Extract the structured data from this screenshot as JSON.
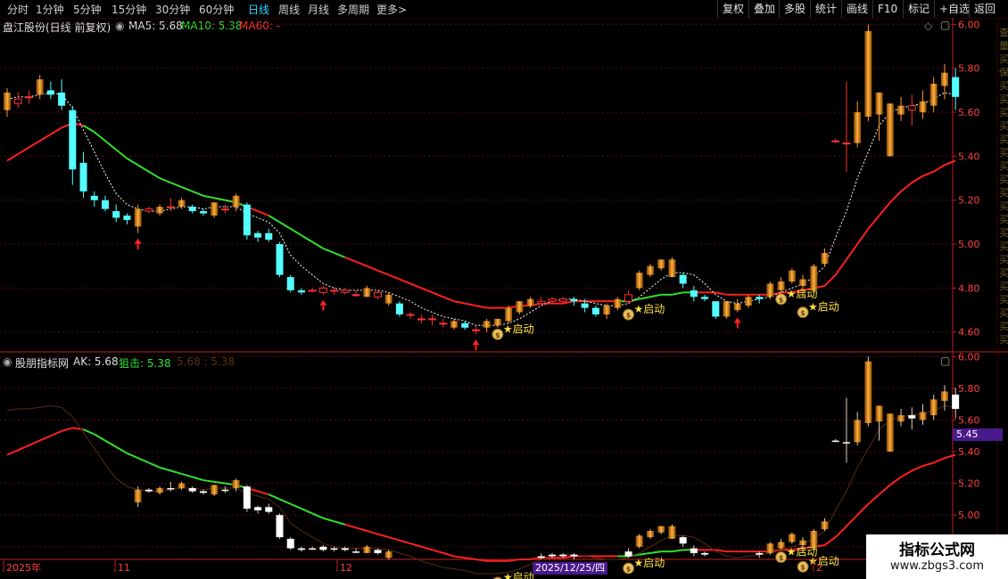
{
  "toolbar": {
    "periods": [
      "分时",
      "1分钟",
      "5分钟",
      "15分钟",
      "30分钟",
      "60分钟",
      "日线",
      "周线",
      "月线",
      "多周期",
      "更多"
    ],
    "active_period": "日线",
    "more_arrow": ">",
    "actions": [
      "复权",
      "叠加",
      "多股",
      "统计",
      "画线",
      "F10",
      "标记",
      "+自选",
      "返回"
    ]
  },
  "main_header": {
    "stock_title": "盘江股份(日线 前复权)",
    "ma5_label": "MA5: 5.68",
    "ma10_label": "MA10: 5.38",
    "ma60_label": "MA60: -"
  },
  "sub_header": {
    "indicator_name": "股朋指标网",
    "ak_label": "AK: 5.68",
    "zj_label": "狙击: 5.38",
    "extra_label": "5.68 : 5.38"
  },
  "signal_label": "★启动",
  "cursor_price": "5.45",
  "cursor_date": "2025/12/25/四",
  "x_axis_labels": [
    "2025年",
    "11",
    "12",
    "2"
  ],
  "right_strip_chars": [
    "查",
    "量",
    "买",
    "保",
    "买",
    "买",
    "买",
    "买",
    "买",
    "买",
    "买",
    "买",
    "买",
    "买",
    "买",
    "买",
    "买",
    "买",
    "买",
    "买",
    "买",
    "买",
    "买",
    "买",
    "买",
    "买",
    "买",
    "买",
    "买",
    "买",
    "买",
    "买",
    "买",
    "买",
    "买",
    "买",
    "买",
    "买",
    "买",
    "买",
    "买",
    "买",
    "买",
    "买",
    "买",
    "买",
    "买",
    "买",
    "买",
    "买",
    "买"
  ],
  "watermark": {
    "logo": "指标公式网",
    "url": "www.zbgs3.com"
  },
  "colors": {
    "up": "#ff3232",
    "down": "#54ffff",
    "ma_red": "#ff2020",
    "ma_green": "#30e030",
    "grid": "#5a0a0a",
    "axis": "#c02020"
  },
  "chart_data": {
    "type": "candlestick",
    "main_axis": {
      "yticks": [
        4.6,
        4.8,
        5.0,
        5.2,
        5.4,
        5.6,
        5.8,
        6.0
      ],
      "ylim": [
        4.53,
        6.03
      ]
    },
    "sub_axis": {
      "yticks": [
        4.8,
        5.0,
        5.2,
        5.4,
        5.6,
        5.8,
        6.0
      ],
      "ylim": [
        4.72,
        6.03
      ]
    },
    "candles": [
      {
        "o": 5.61,
        "c": 5.69,
        "h": 5.71,
        "l": 5.58
      },
      {
        "o": 5.64,
        "c": 5.66,
        "h": 5.69,
        "l": 5.62
      },
      {
        "o": 5.67,
        "c": 5.67,
        "h": 5.7,
        "l": 5.64
      },
      {
        "o": 5.68,
        "c": 5.75,
        "h": 5.77,
        "l": 5.66
      },
      {
        "o": 5.7,
        "c": 5.68,
        "h": 5.74,
        "l": 5.66
      },
      {
        "o": 5.69,
        "c": 5.63,
        "h": 5.75,
        "l": 5.61
      },
      {
        "o": 5.61,
        "c": 5.34,
        "h": 5.63,
        "l": 5.27
      },
      {
        "o": 5.37,
        "c": 5.24,
        "h": 5.42,
        "l": 5.21
      },
      {
        "o": 5.22,
        "c": 5.2,
        "h": 5.24,
        "l": 5.17
      },
      {
        "o": 5.2,
        "c": 5.16,
        "h": 5.22,
        "l": 5.15
      },
      {
        "o": 5.15,
        "c": 5.12,
        "h": 5.18,
        "l": 5.1
      },
      {
        "o": 5.13,
        "c": 5.11,
        "h": 5.14,
        "l": 5.09
      },
      {
        "o": 5.08,
        "c": 5.16,
        "h": 5.18,
        "l": 5.05
      },
      {
        "o": 5.15,
        "c": 5.16,
        "h": 5.17,
        "l": 5.14
      },
      {
        "o": 5.14,
        "c": 5.17,
        "h": 5.18,
        "l": 5.13
      },
      {
        "o": 5.17,
        "c": 5.17,
        "h": 5.21,
        "l": 5.15
      },
      {
        "o": 5.17,
        "c": 5.2,
        "h": 5.21,
        "l": 5.16
      },
      {
        "o": 5.17,
        "c": 5.15,
        "h": 5.18,
        "l": 5.14
      },
      {
        "o": 5.15,
        "c": 5.14,
        "h": 5.16,
        "l": 5.13
      },
      {
        "o": 5.13,
        "c": 5.19,
        "h": 5.19,
        "l": 5.12
      },
      {
        "o": 5.16,
        "c": 5.16,
        "h": 5.18,
        "l": 5.14
      },
      {
        "o": 5.17,
        "c": 5.22,
        "h": 5.23,
        "l": 5.15
      },
      {
        "o": 5.18,
        "c": 5.04,
        "h": 5.19,
        "l": 5.02
      },
      {
        "o": 5.05,
        "c": 5.03,
        "h": 5.06,
        "l": 5.01
      },
      {
        "o": 5.05,
        "c": 5.02,
        "h": 5.07,
        "l": 5.01
      },
      {
        "o": 5.0,
        "c": 4.86,
        "h": 5.01,
        "l": 4.85
      },
      {
        "o": 4.85,
        "c": 4.79,
        "h": 4.86,
        "l": 4.78
      },
      {
        "o": 4.79,
        "c": 4.78,
        "h": 4.8,
        "l": 4.77
      },
      {
        "o": 4.79,
        "c": 4.79,
        "h": 4.8,
        "l": 4.78
      },
      {
        "o": 4.78,
        "c": 4.8,
        "h": 4.81,
        "l": 4.77
      },
      {
        "o": 4.79,
        "c": 4.79,
        "h": 4.8,
        "l": 4.77
      },
      {
        "o": 4.78,
        "c": 4.79,
        "h": 4.8,
        "l": 4.77
      },
      {
        "o": 4.77,
        "c": 4.77,
        "h": 4.79,
        "l": 4.76
      },
      {
        "o": 4.76,
        "c": 4.8,
        "h": 4.81,
        "l": 4.76
      },
      {
        "o": 4.76,
        "c": 4.78,
        "h": 4.79,
        "l": 4.75
      },
      {
        "o": 4.73,
        "c": 4.77,
        "h": 4.78,
        "l": 4.72
      },
      {
        "o": 4.73,
        "c": 4.68,
        "h": 4.74,
        "l": 4.67
      },
      {
        "o": 4.68,
        "c": 4.68,
        "h": 4.69,
        "l": 4.66
      },
      {
        "o": 4.66,
        "c": 4.66,
        "h": 4.68,
        "l": 4.64
      },
      {
        "o": 4.66,
        "c": 4.66,
        "h": 4.68,
        "l": 4.63
      },
      {
        "o": 4.64,
        "c": 4.64,
        "h": 4.66,
        "l": 4.62
      },
      {
        "o": 4.62,
        "c": 4.65,
        "h": 4.66,
        "l": 4.61
      },
      {
        "o": 4.64,
        "c": 4.62,
        "h": 4.65,
        "l": 4.61
      },
      {
        "o": 4.61,
        "c": 4.61,
        "h": 4.63,
        "l": 4.59
      },
      {
        "o": 4.62,
        "c": 4.65,
        "h": 4.66,
        "l": 4.6
      },
      {
        "o": 4.63,
        "c": 4.66,
        "h": 4.66,
        "l": 4.62
      },
      {
        "o": 4.65,
        "c": 4.71,
        "h": 4.72,
        "l": 4.64
      },
      {
        "o": 4.69,
        "c": 4.74,
        "h": 4.74,
        "l": 4.68
      },
      {
        "o": 4.72,
        "c": 4.75,
        "h": 4.76,
        "l": 4.71
      },
      {
        "o": 4.73,
        "c": 4.74,
        "h": 4.76,
        "l": 4.72
      },
      {
        "o": 4.74,
        "c": 4.75,
        "h": 4.76,
        "l": 4.73
      },
      {
        "o": 4.74,
        "c": 4.75,
        "h": 4.76,
        "l": 4.73
      },
      {
        "o": 4.75,
        "c": 4.74,
        "h": 4.76,
        "l": 4.72
      },
      {
        "o": 4.73,
        "c": 4.71,
        "h": 4.75,
        "l": 4.69
      },
      {
        "o": 4.71,
        "c": 4.68,
        "h": 4.72,
        "l": 4.67
      },
      {
        "o": 4.68,
        "c": 4.72,
        "h": 4.73,
        "l": 4.66
      },
      {
        "o": 4.71,
        "c": 4.75,
        "h": 4.76,
        "l": 4.7
      },
      {
        "o": 4.74,
        "c": 4.77,
        "h": 4.79,
        "l": 4.73
      },
      {
        "o": 4.8,
        "c": 4.87,
        "h": 4.88,
        "l": 4.79
      },
      {
        "o": 4.86,
        "c": 4.9,
        "h": 4.91,
        "l": 4.85
      },
      {
        "o": 4.89,
        "c": 4.93,
        "h": 4.93,
        "l": 4.88
      },
      {
        "o": 4.85,
        "c": 4.93,
        "h": 4.94,
        "l": 4.85
      },
      {
        "o": 4.86,
        "c": 4.82,
        "h": 4.87,
        "l": 4.8
      },
      {
        "o": 4.79,
        "c": 4.76,
        "h": 4.81,
        "l": 4.74
      },
      {
        "o": 4.76,
        "c": 4.75,
        "h": 4.77,
        "l": 4.74
      },
      {
        "o": 4.74,
        "c": 4.67,
        "h": 4.74,
        "l": 4.66
      },
      {
        "o": 4.67,
        "c": 4.74,
        "h": 4.74,
        "l": 4.66
      },
      {
        "o": 4.7,
        "c": 4.73,
        "h": 4.75,
        "l": 4.69
      },
      {
        "o": 4.72,
        "c": 4.76,
        "h": 4.77,
        "l": 4.71
      },
      {
        "o": 4.76,
        "c": 4.75,
        "h": 4.77,
        "l": 4.73
      },
      {
        "o": 4.76,
        "c": 4.82,
        "h": 4.83,
        "l": 4.75
      },
      {
        "o": 4.79,
        "c": 4.83,
        "h": 4.85,
        "l": 4.78
      },
      {
        "o": 4.83,
        "c": 4.88,
        "h": 4.89,
        "l": 4.82
      },
      {
        "o": 4.81,
        "c": 4.84,
        "h": 4.86,
        "l": 4.76
      },
      {
        "o": 4.79,
        "c": 4.9,
        "h": 4.91,
        "l": 4.78
      },
      {
        "o": 4.91,
        "c": 4.96,
        "h": 4.98,
        "l": 4.9
      },
      {
        "o": 5.47,
        "c": 5.47,
        "h": 5.48,
        "l": 5.46
      },
      {
        "o": 5.46,
        "c": 5.46,
        "h": 5.74,
        "l": 5.33
      },
      {
        "o": 5.46,
        "c": 5.6,
        "h": 5.65,
        "l": 5.44
      },
      {
        "o": 5.58,
        "c": 5.97,
        "h": 6.0,
        "l": 5.56
      },
      {
        "o": 5.59,
        "c": 5.69,
        "h": 5.69,
        "l": 5.47
      },
      {
        "o": 5.4,
        "c": 5.64,
        "h": 5.64,
        "l": 5.4
      },
      {
        "o": 5.59,
        "c": 5.63,
        "h": 5.67,
        "l": 5.56
      },
      {
        "o": 5.61,
        "c": 5.63,
        "h": 5.68,
        "l": 5.54
      },
      {
        "o": 5.6,
        "c": 5.65,
        "h": 5.7,
        "l": 5.57
      },
      {
        "o": 5.63,
        "c": 5.73,
        "h": 5.76,
        "l": 5.6
      },
      {
        "o": 5.72,
        "c": 5.78,
        "h": 5.82,
        "l": 5.66
      },
      {
        "o": 5.76,
        "c": 5.67,
        "h": 5.8,
        "l": 5.61
      }
    ],
    "ma5": [
      5.66,
      5.67,
      5.67,
      5.68,
      5.69,
      5.68,
      5.62,
      5.52,
      5.42,
      5.32,
      5.23,
      5.18,
      5.16,
      5.15,
      5.15,
      5.16,
      5.17,
      5.17,
      5.16,
      5.17,
      5.17,
      5.17,
      5.14,
      5.12,
      5.1,
      5.05,
      4.95,
      4.9,
      4.86,
      4.82,
      4.8,
      4.79,
      4.79,
      4.79,
      4.79,
      4.78,
      4.76,
      4.74,
      4.71,
      4.69,
      4.67,
      4.66,
      4.65,
      4.63,
      4.63,
      4.63,
      4.64,
      4.66,
      4.69,
      4.72,
      4.74,
      4.75,
      4.75,
      4.74,
      4.73,
      4.72,
      4.72,
      4.73,
      4.76,
      4.8,
      4.84,
      4.87,
      4.87,
      4.86,
      4.82,
      4.77,
      4.74,
      4.73,
      4.74,
      4.75,
      4.76,
      4.78,
      4.8,
      4.82,
      4.85,
      4.9,
      5.03,
      5.15,
      5.3,
      5.42,
      5.54,
      5.6,
      5.62,
      5.63,
      5.64,
      5.66,
      5.69,
      5.68
    ],
    "zj": [
      5.38,
      5.41,
      5.44,
      5.47,
      5.5,
      5.53,
      5.55,
      5.54,
      5.51,
      5.47,
      5.43,
      5.39,
      5.36,
      5.33,
      5.3,
      5.28,
      5.26,
      5.24,
      5.22,
      5.21,
      5.2,
      5.19,
      5.17,
      5.15,
      5.13,
      5.1,
      5.07,
      5.04,
      5.01,
      4.98,
      4.96,
      4.94,
      4.92,
      4.9,
      4.88,
      4.86,
      4.84,
      4.82,
      4.8,
      4.78,
      4.76,
      4.74,
      4.73,
      4.72,
      4.71,
      4.71,
      4.71,
      4.72,
      4.72,
      4.73,
      4.73,
      4.73,
      4.74,
      4.74,
      4.74,
      4.74,
      4.74,
      4.74,
      4.75,
      4.76,
      4.77,
      4.77,
      4.78,
      4.78,
      4.78,
      4.78,
      4.77,
      4.77,
      4.77,
      4.77,
      4.77,
      4.78,
      4.78,
      4.79,
      4.8,
      4.81,
      4.86,
      4.93,
      5.0,
      5.07,
      5.13,
      5.19,
      5.24,
      5.28,
      5.31,
      5.33,
      5.36,
      5.38
    ],
    "zj_trend": [
      "down",
      "down",
      "down",
      "down",
      "down",
      "down",
      "down",
      "up",
      "up",
      "up",
      "up",
      "up",
      "up",
      "up",
      "up",
      "up",
      "up",
      "up",
      "up",
      "up",
      "up",
      "up",
      "down",
      "down",
      "up",
      "up",
      "up",
      "up",
      "up",
      "up",
      "up",
      "down",
      "down",
      "down",
      "down",
      "down",
      "down",
      "down",
      "down",
      "down",
      "down",
      "down",
      "down",
      "down",
      "down",
      "down",
      "down",
      "down",
      "down",
      "down",
      "down",
      "down",
      "down",
      "down",
      "down",
      "down",
      "up",
      "up",
      "up",
      "up",
      "up",
      "up",
      "up",
      "down",
      "down",
      "down",
      "down",
      "down",
      "down",
      "down",
      "down",
      "down",
      "down",
      "down",
      "down",
      "down",
      "down",
      "down",
      "down",
      "down",
      "down",
      "down",
      "down",
      "down",
      "down",
      "down",
      "down",
      "down"
    ],
    "buy_arrows": [
      12,
      29,
      43,
      67
    ],
    "signals": [
      {
        "index": 45,
        "price": 4.63
      },
      {
        "index": 57,
        "price": 4.72
      },
      {
        "index": 71,
        "price": 4.79
      },
      {
        "index": 73,
        "price": 4.73
      }
    ]
  }
}
